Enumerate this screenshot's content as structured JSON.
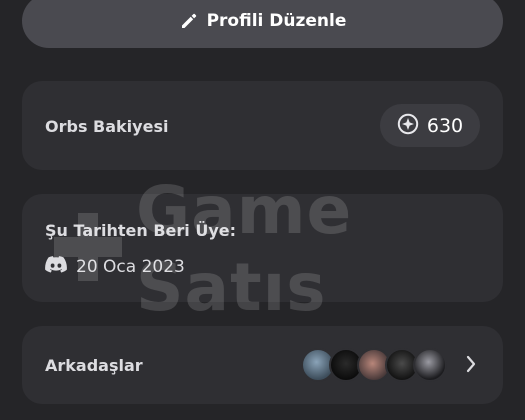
{
  "edit_profile": {
    "label": "Profili Düzenle",
    "icon": "pencil-icon"
  },
  "orbs": {
    "title": "Orbs Bakiyesi",
    "balance": "630",
    "icon": "orb-icon"
  },
  "member_since": {
    "title": "Şu Tarihten Beri Üye:",
    "date": "20 Oca 2023",
    "icon": "discord-icon"
  },
  "friends": {
    "title": "Arkadaşlar",
    "avatar_count": 5,
    "chevron_icon": "chevron-right-icon"
  },
  "watermark": {
    "text": "Game Satıs"
  },
  "colors": {
    "background": "#252528",
    "card": "#2f2f33",
    "button": "#4a4a50",
    "pill": "#3c3c41",
    "text": "#dcdce0"
  }
}
